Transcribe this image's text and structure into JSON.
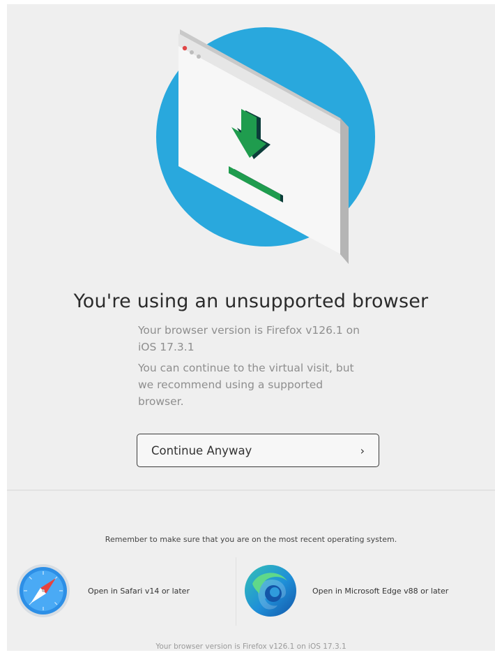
{
  "main": {
    "title": "You're using an unsupported browser",
    "version_message": "Your browser version is Firefox v126.1 on iOS 17.3.1",
    "continue_message": "You can continue to the virtual visit, but we recommend using a supported browser.",
    "continue_button_label": "Continue Anyway",
    "continue_button_icon": "chevron-right-icon"
  },
  "browsers": {
    "reminder": "Remember to make sure that you are on the most recent operating system.",
    "safari": {
      "label": "Open in Safari v14 or later",
      "icon": "safari-icon"
    },
    "edge": {
      "label": "Open in Microsoft Edge v88 or later",
      "icon": "edge-icon"
    }
  },
  "footer": {
    "version_text": "Your browser version is Firefox v126.1 on iOS 17.3.1"
  },
  "colors": {
    "circle": "#29a8dd",
    "arrow": "#1f9c4e",
    "arrow_shadow": "#0c3d3a",
    "background": "#efefef"
  }
}
